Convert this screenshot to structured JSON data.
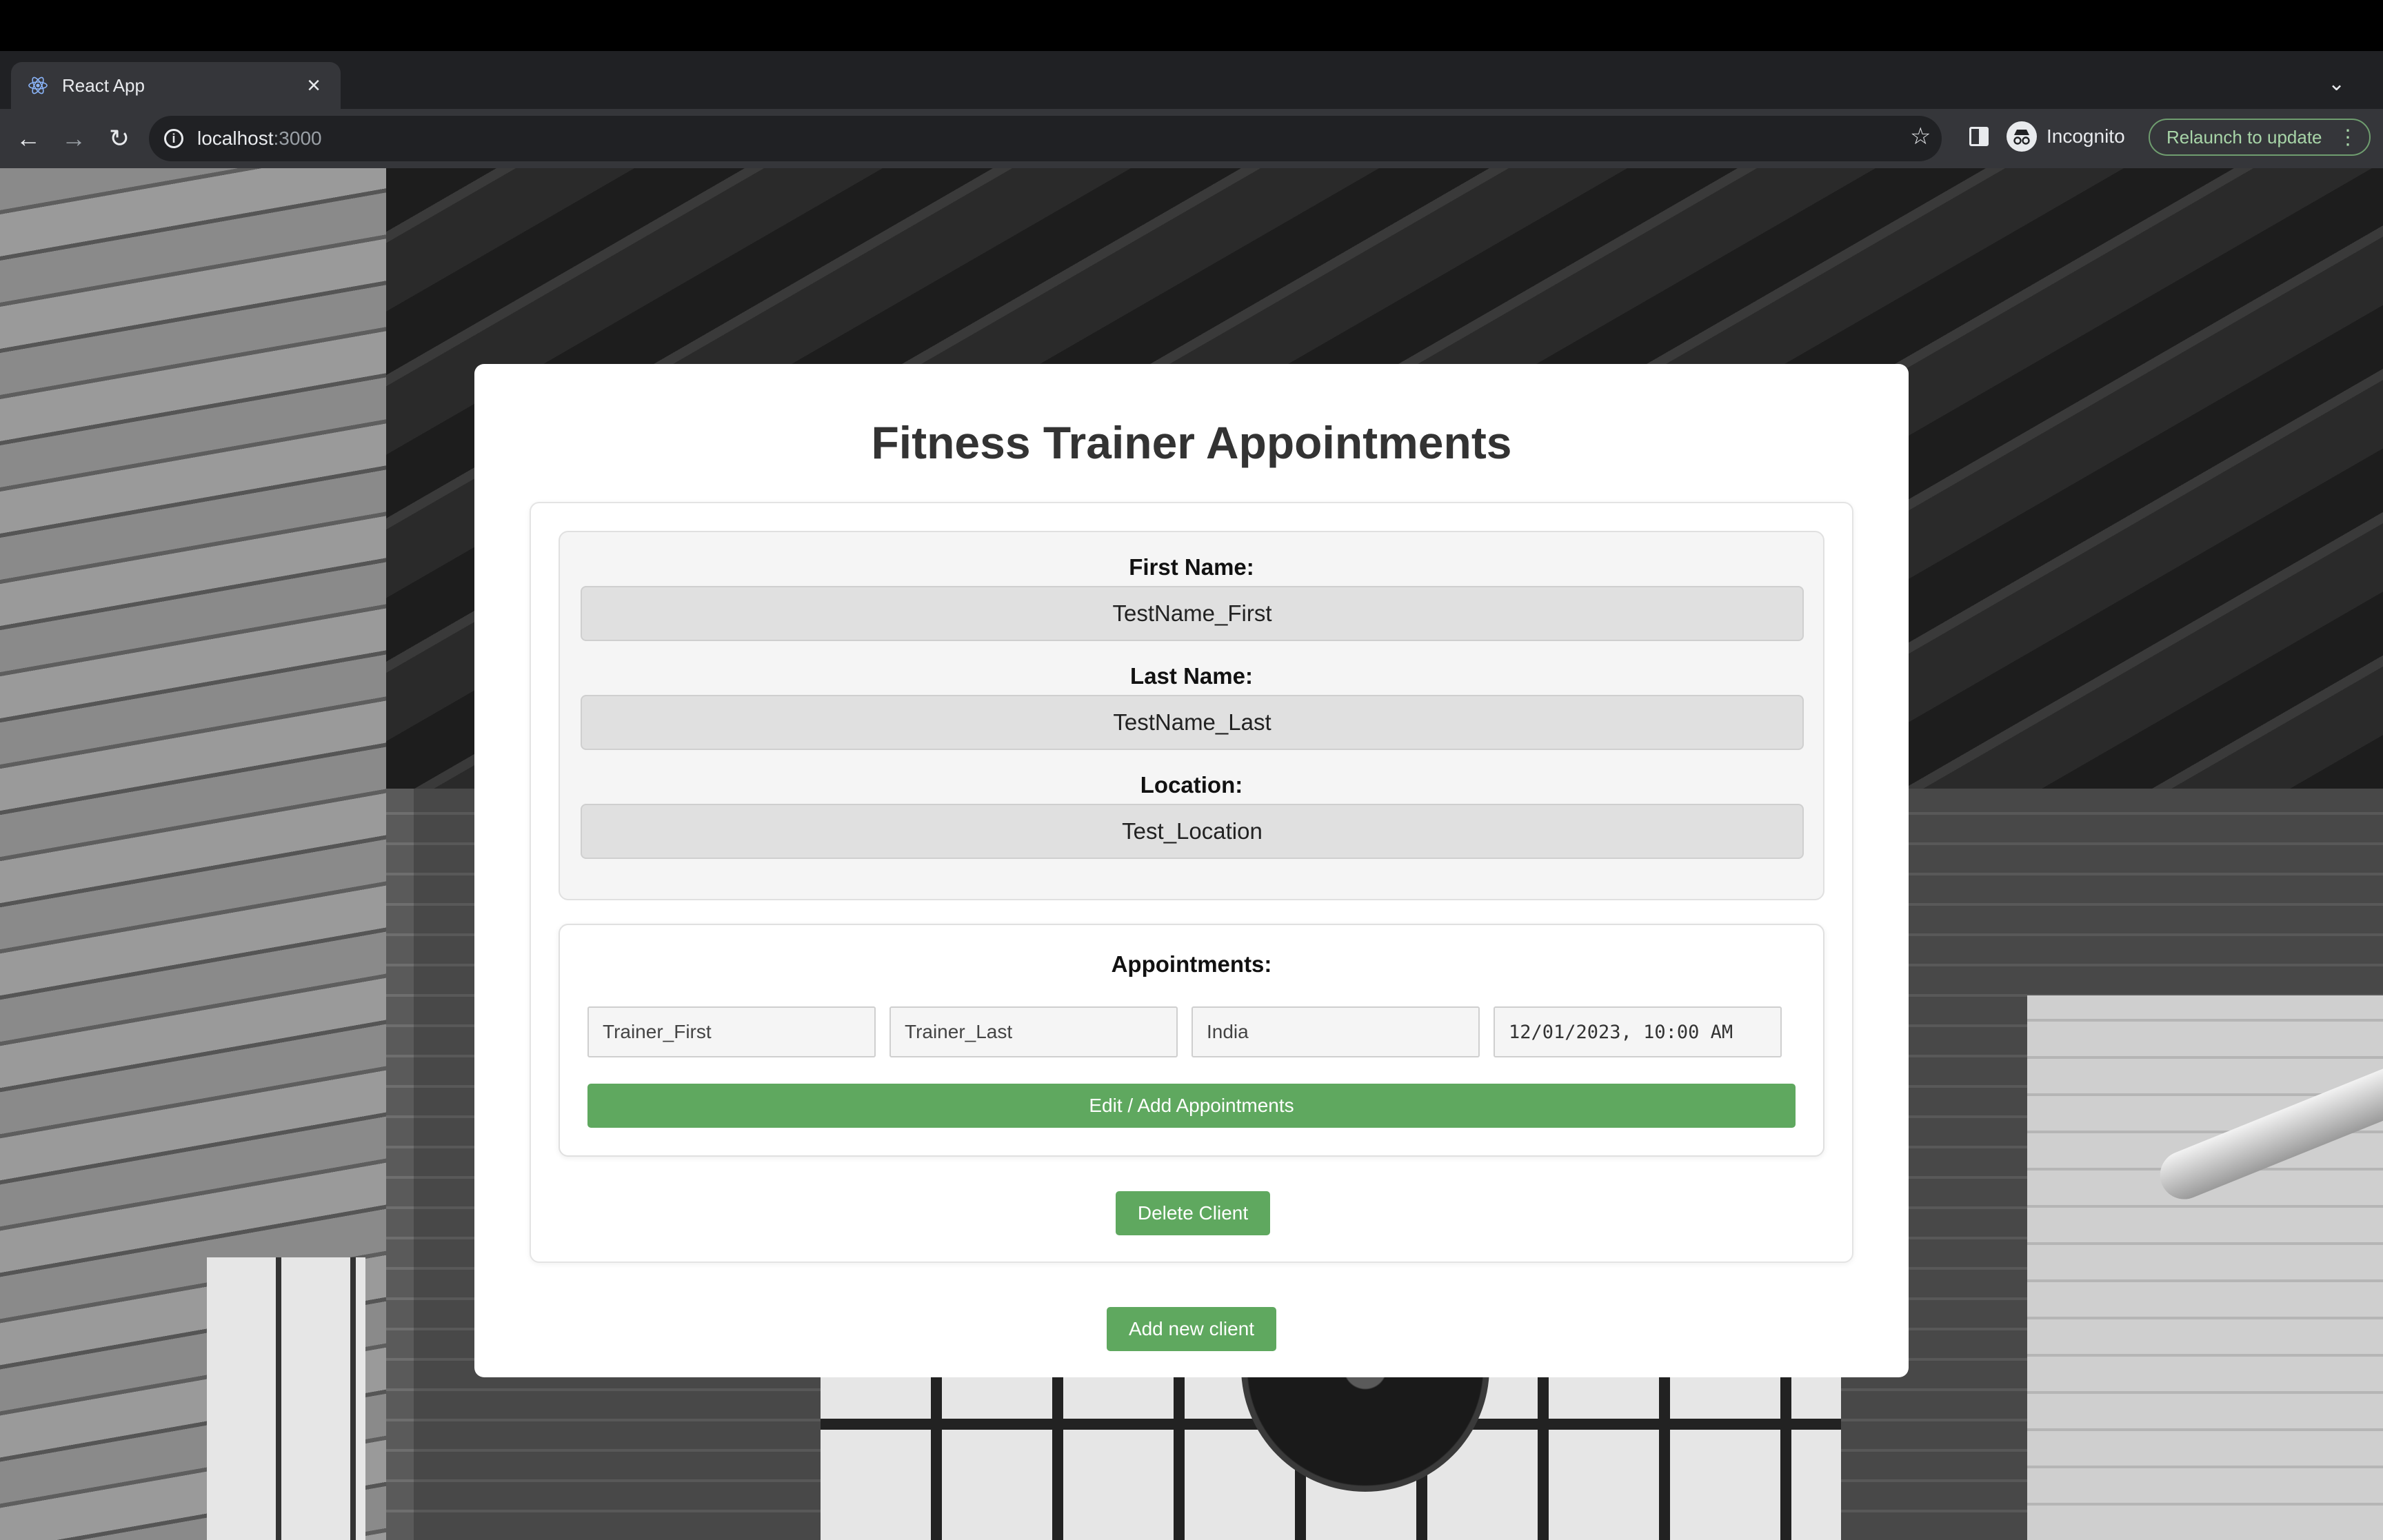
{
  "browser": {
    "tab_title": "React App",
    "url_host": "localhost",
    "url_port": ":3000",
    "incognito_label": "Incognito",
    "relaunch_label": "Relaunch to update",
    "icons": {
      "favicon": "react-icon",
      "close": "close-icon",
      "new_tab": "plus-icon",
      "back": "back-arrow-icon",
      "forward": "forward-arrow-icon",
      "reload": "reload-icon",
      "info": "info-icon",
      "bookmark": "star-icon",
      "side_panel": "side-panel-icon",
      "incognito": "incognito-icon",
      "menu": "kebab-menu-icon",
      "tab_search": "chevron-down-icon"
    }
  },
  "page": {
    "title": "Fitness Trainer Appointments",
    "client": {
      "first_name_label": "First Name:",
      "first_name": "TestName_First",
      "last_name_label": "Last Name:",
      "last_name": "TestName_Last",
      "location_label": "Location:",
      "location": "Test_Location"
    },
    "appointments": {
      "title": "Appointments:",
      "items": [
        {
          "trainer_first": "Trainer_First",
          "trainer_last": "Trainer_Last",
          "location": "India",
          "datetime": "12/01/2023, 10:00 AM"
        }
      ],
      "edit_button": "Edit / Add Appointments"
    },
    "delete_button": "Delete Client",
    "add_button": "Add new client"
  },
  "colors": {
    "button_green": "#5fa85f",
    "card_bg": "#ffffff",
    "field_bg": "#e0e0e0",
    "title_text": "#333333"
  }
}
